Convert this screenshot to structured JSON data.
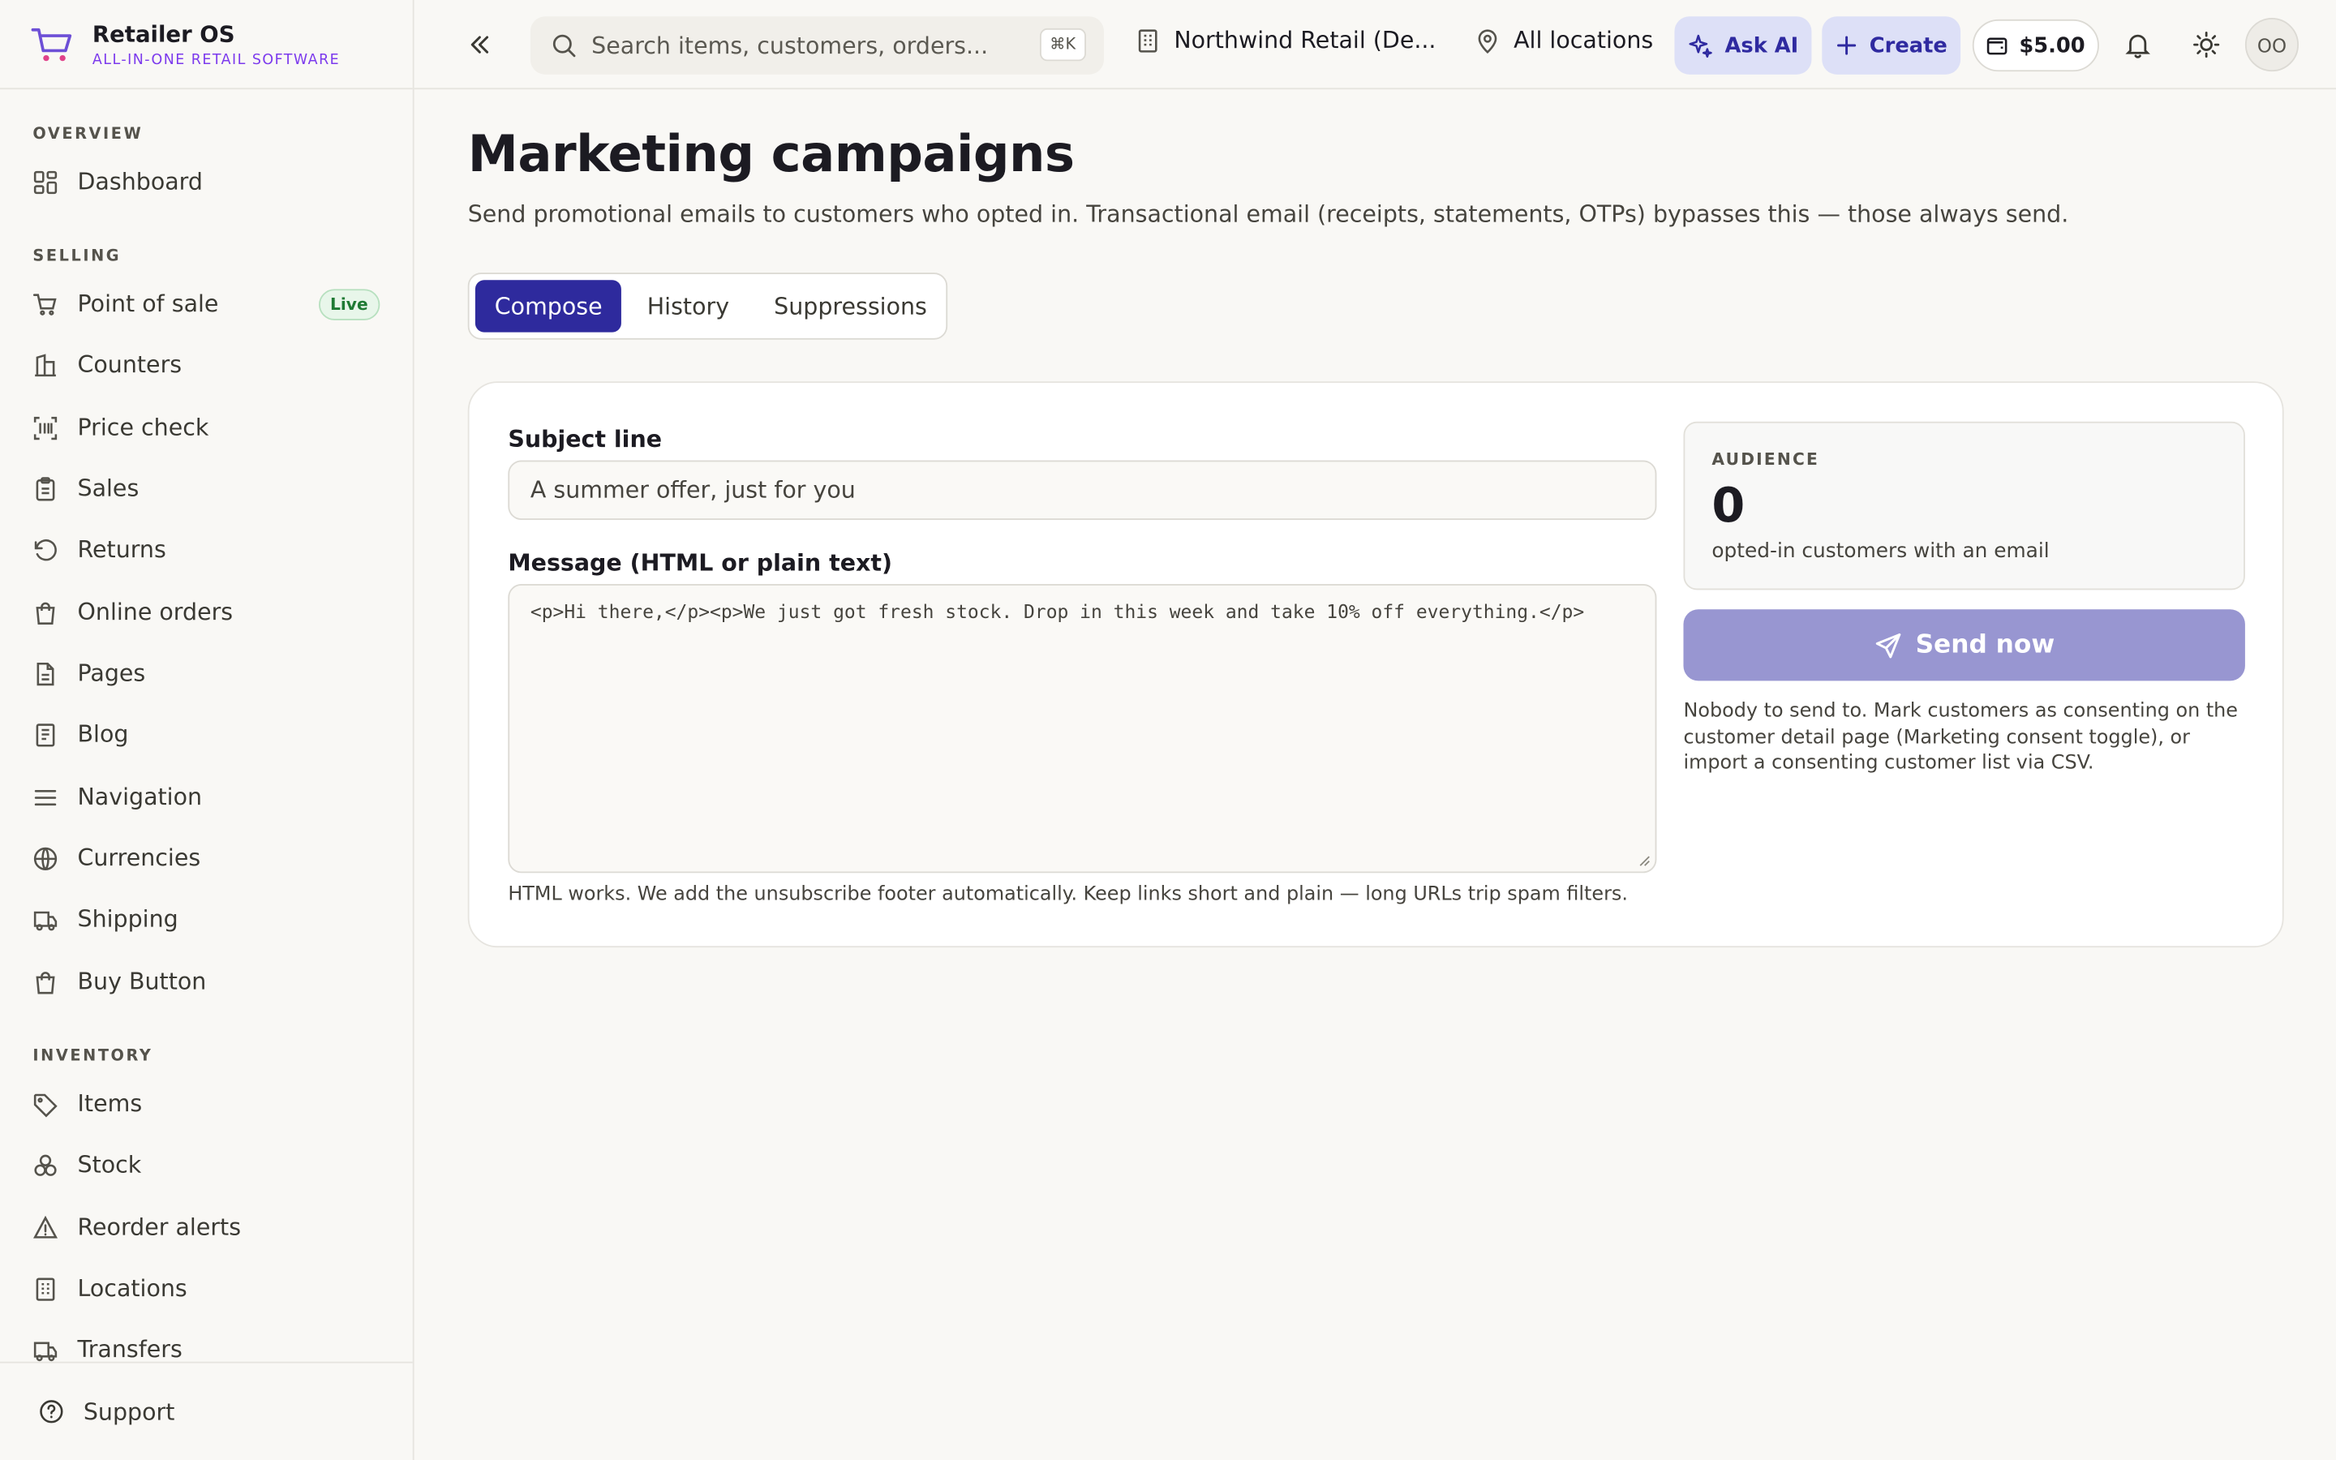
{
  "brand": {
    "name": "Retailer OS",
    "tagline": "ALL-IN-ONE RETAIL SOFTWARE",
    "accent": "#7c3aed"
  },
  "sidebar": {
    "sections": [
      {
        "title": "OVERVIEW",
        "items": [
          {
            "label": "Dashboard",
            "icon": "dashboard-icon"
          }
        ]
      },
      {
        "title": "SELLING",
        "items": [
          {
            "label": "Point of sale",
            "icon": "cart-icon",
            "badge": "Live"
          },
          {
            "label": "Counters",
            "icon": "counter-icon"
          },
          {
            "label": "Price check",
            "icon": "barcode-icon"
          },
          {
            "label": "Sales",
            "icon": "clipboard-icon"
          },
          {
            "label": "Returns",
            "icon": "undo-icon"
          },
          {
            "label": "Online orders",
            "icon": "shopping-bag-icon"
          },
          {
            "label": "Pages",
            "icon": "page-icon"
          },
          {
            "label": "Blog",
            "icon": "newspaper-icon"
          },
          {
            "label": "Navigation",
            "icon": "menu-icon"
          },
          {
            "label": "Currencies",
            "icon": "globe-icon"
          },
          {
            "label": "Shipping",
            "icon": "truck-icon"
          },
          {
            "label": "Buy Button",
            "icon": "shopping-bag-icon"
          }
        ]
      },
      {
        "title": "INVENTORY",
        "items": [
          {
            "label": "Items",
            "icon": "tag-icon"
          },
          {
            "label": "Stock",
            "icon": "boxes-icon"
          },
          {
            "label": "Reorder alerts",
            "icon": "warning-icon"
          },
          {
            "label": "Locations",
            "icon": "building-icon"
          },
          {
            "label": "Transfers",
            "icon": "truck-icon"
          }
        ]
      }
    ],
    "footer": {
      "label": "Support",
      "icon": "help-icon"
    }
  },
  "header": {
    "search_placeholder": "Search items, customers, orders...",
    "shortcut": "⌘K",
    "org": "Northwind Retail (De...",
    "location": "All locations",
    "ask_ai": "Ask AI",
    "create": "Create",
    "balance": "$5.00",
    "avatar": "OO"
  },
  "page": {
    "title": "Marketing campaigns",
    "description": "Send promotional emails to customers who opted in. Transactional email (receipts, statements, OTPs) bypasses this — those always send.",
    "tabs": [
      {
        "label": "Compose",
        "active": true
      },
      {
        "label": "History",
        "active": false
      },
      {
        "label": "Suppressions",
        "active": false
      }
    ]
  },
  "compose": {
    "subject_label": "Subject line",
    "subject_value": "A summer offer, just for you",
    "message_label": "Message (HTML or plain text)",
    "message_value": "<p>Hi there,</p><p>We just got fresh stock. Drop in this week and take 10% off everything.</p>",
    "hint": "HTML works. We add the unsubscribe footer automatically. Keep links short and plain — long URLs trip spam filters."
  },
  "audience": {
    "title": "AUDIENCE",
    "count": "0",
    "subtitle": "opted-in customers with an email",
    "send_label": "Send now",
    "note": "Nobody to send to. Mark customers as consenting on the customer detail page (Marketing consent toggle), or import a consenting customer list via CSV."
  },
  "colors": {
    "primary": "#2e2a9d",
    "primary_disabled": "#9896d1",
    "background": "#f9f8f5"
  }
}
